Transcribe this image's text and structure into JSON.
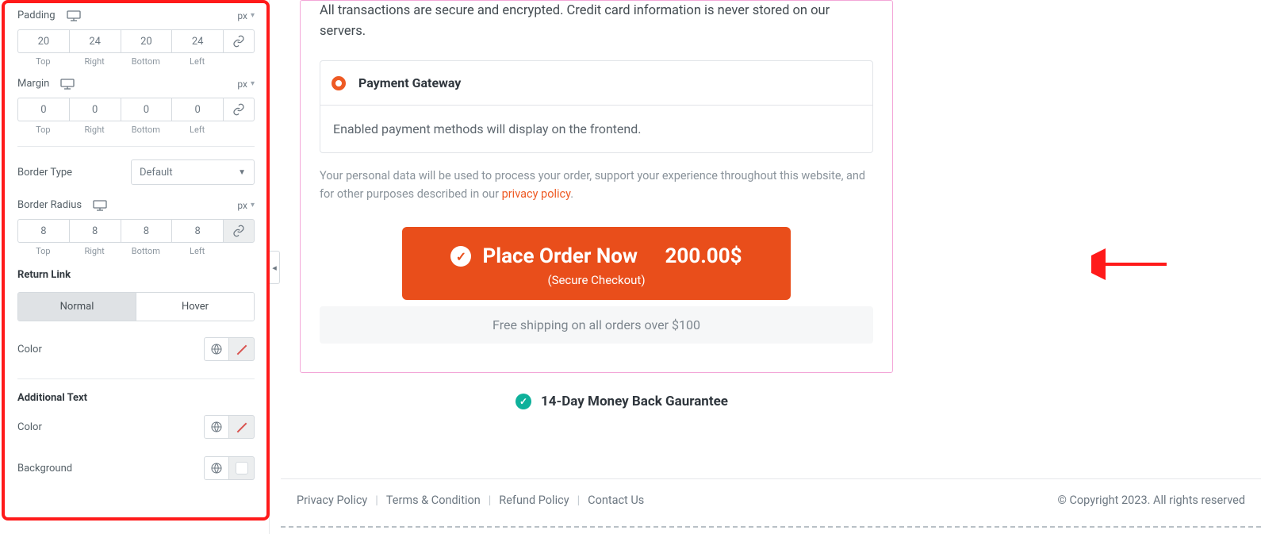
{
  "panel": {
    "padding": {
      "label": "Padding",
      "unit": "px",
      "top": "20",
      "right": "24",
      "bottom": "20",
      "left": "24",
      "linked": false,
      "sides": [
        "Top",
        "Right",
        "Bottom",
        "Left"
      ]
    },
    "margin": {
      "label": "Margin",
      "unit": "px",
      "top": "0",
      "right": "0",
      "bottom": "0",
      "left": "0",
      "linked": false,
      "sides": [
        "Top",
        "Right",
        "Bottom",
        "Left"
      ]
    },
    "border_type": {
      "label": "Border Type",
      "value": "Default"
    },
    "border_radius": {
      "label": "Border Radius",
      "unit": "px",
      "top": "8",
      "right": "8",
      "bottom": "8",
      "left": "8",
      "linked": true,
      "sides": [
        "Top",
        "Right",
        "Bottom",
        "Left"
      ]
    },
    "return_link": {
      "heading": "Return Link",
      "tabs": [
        "Normal",
        "Hover"
      ],
      "active_tab": 0,
      "color_label": "Color"
    },
    "additional_text": {
      "heading": "Additional Text",
      "color_label": "Color",
      "background_label": "Background"
    }
  },
  "preview": {
    "secure_text": "All transactions are secure and encrypted. Credit card information is never stored on our servers.",
    "gateway_title": "Payment Gateway",
    "gateway_body": "Enabled payment methods will display on the frontend.",
    "privacy_text_full": "Your personal data will be used to process your order, support your experience throughout this website, and for other purposes described in our ",
    "privacy_link_label": "privacy policy",
    "privacy_period": ".",
    "order_btn_label": "Place Order Now",
    "order_btn_price": "200.00$",
    "order_btn_sub": "(Secure Checkout)",
    "shipping_bar": "Free shipping on all orders over $100",
    "guarantee": "14-Day Money Back Gaurantee",
    "footer_links": [
      "Privacy Policy",
      "Terms & Condition",
      "Refund Policy",
      "Contact Us"
    ],
    "copyright": "© Copyright 2023. All rights reserved"
  }
}
